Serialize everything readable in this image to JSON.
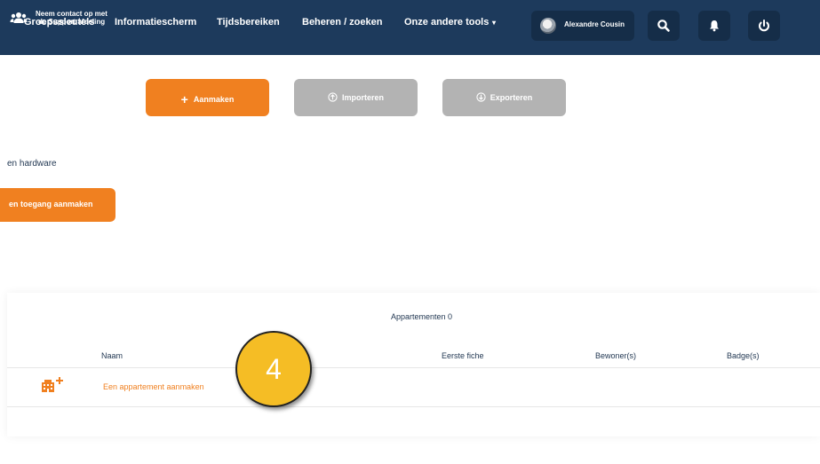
{
  "nav": {
    "items": [
      "Groepssleutels",
      "Informatiescherm",
      "Tijdsbereiken",
      "Beheren / zoeken",
      "Onze andere tools"
    ],
    "dropdown_caret": "▾",
    "user_name": "Alexandre Cousin"
  },
  "actions": {
    "create": "Aanmaken",
    "import": "Importeren",
    "export": "Exporteren",
    "support_line1": "Neem contact op met",
    "support_line2": "de Support afdeling"
  },
  "section": {
    "hardware_text": "en hardware",
    "access_button": "en toegang aanmaken"
  },
  "table": {
    "title": "Appartementen 0",
    "headers": [
      "Naam",
      "Eerste fiche",
      "Bewoner(s)",
      "Badge(s)"
    ],
    "create_row_label": "Een appartement aanmaken"
  },
  "marker": {
    "number": "4"
  },
  "colors": {
    "nav": "#1d3a5c",
    "accent": "#f08020",
    "disabled": "#b3b3b3",
    "marker": "#f5bd25"
  }
}
